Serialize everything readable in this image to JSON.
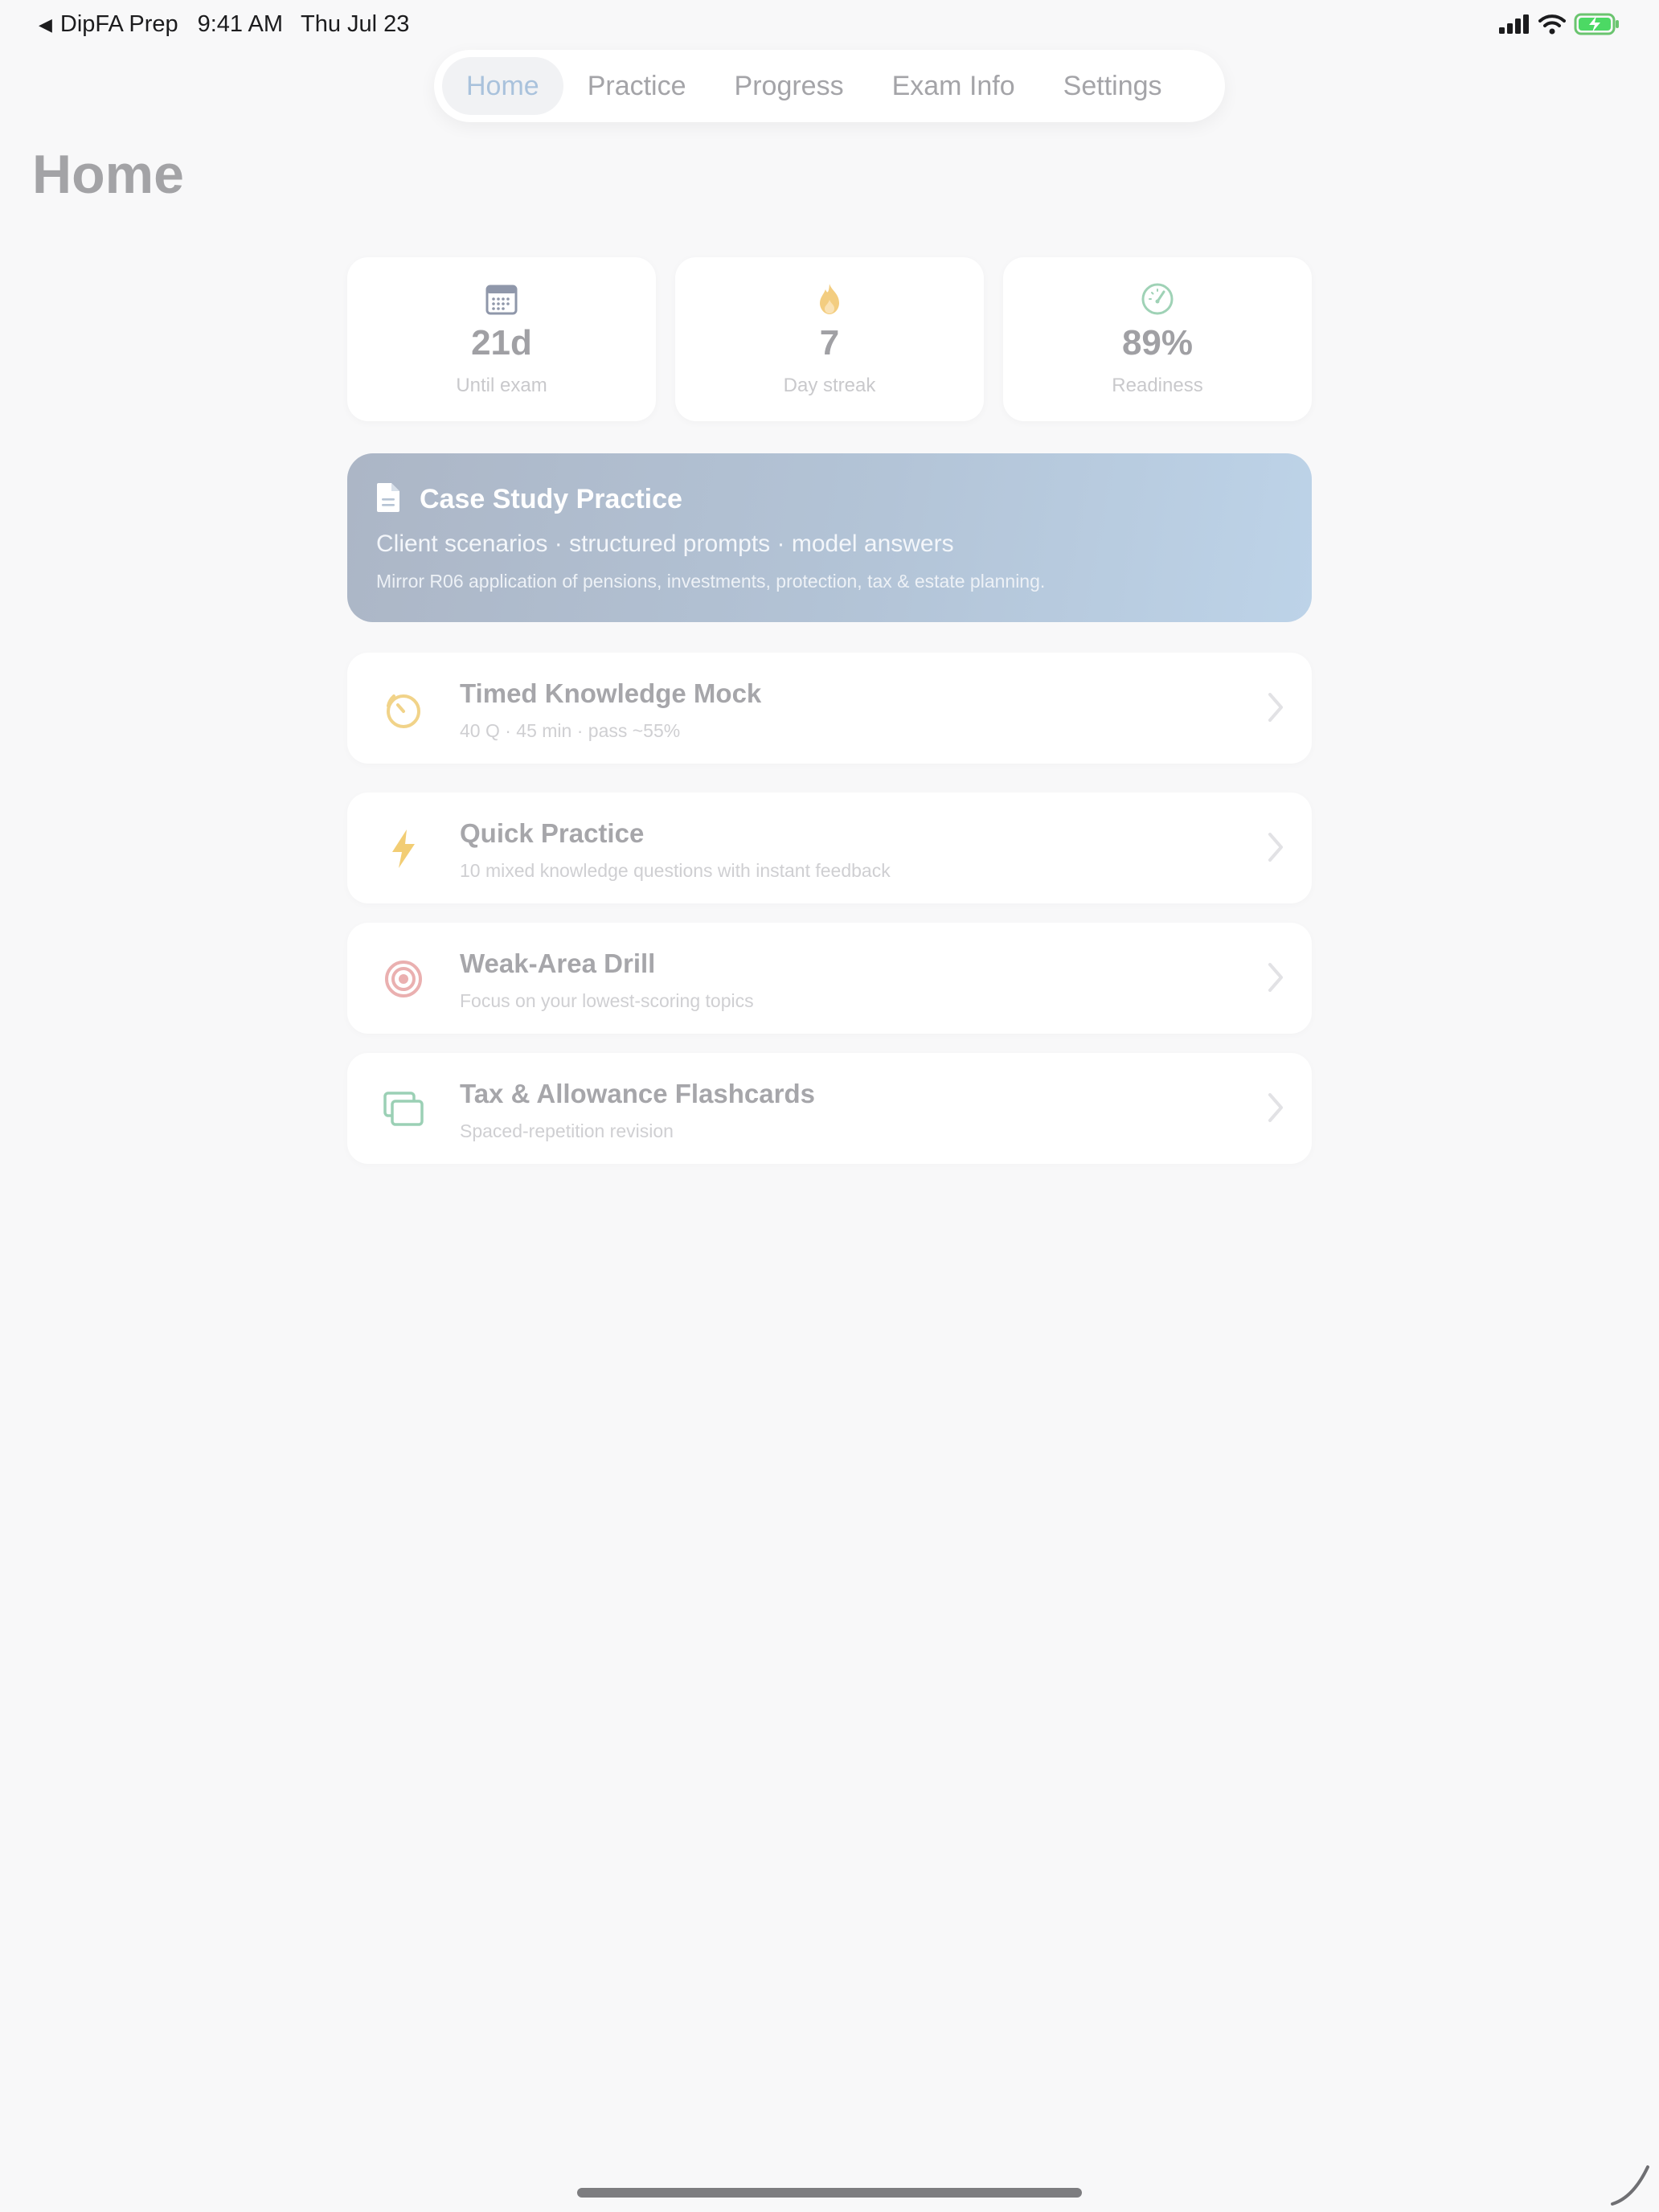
{
  "status_bar": {
    "back_app": "DipFA Prep",
    "time": "9:41 AM",
    "date": "Thu Jul 23"
  },
  "tabs": [
    {
      "label": "Home",
      "active": true
    },
    {
      "label": "Practice",
      "active": false
    },
    {
      "label": "Progress",
      "active": false
    },
    {
      "label": "Exam Info",
      "active": false
    },
    {
      "label": "Settings",
      "active": false
    }
  ],
  "page_title": "Home",
  "stats": [
    {
      "icon": "calendar-icon",
      "value": "21d",
      "label": "Until exam",
      "color": "#8f97aa"
    },
    {
      "icon": "flame-icon",
      "value": "7",
      "label": "Day streak",
      "color": "#f1c87a"
    },
    {
      "icon": "gauge-icon",
      "value": "89%",
      "label": "Readiness",
      "color": "#9fd2b6"
    }
  ],
  "case_study": {
    "icon": "document-icon",
    "title": "Case Study Practice",
    "subtitle": "Client scenarios · structured prompts · model answers",
    "description": "Mirror R06 application of pensions, investments, protection, tax & estate planning."
  },
  "list": [
    {
      "icon": "timer-icon",
      "title": "Timed Knowledge Mock",
      "subtitle": "40 Q · 45 min · pass ~55%",
      "color": "#f1d389"
    },
    {
      "icon": "bolt-icon",
      "title": "Quick Practice",
      "subtitle": "10 mixed knowledge questions with instant feedback",
      "color": "#f2cd74"
    },
    {
      "icon": "target-icon",
      "title": "Weak-Area Drill",
      "subtitle": "Focus on your lowest-scoring topics",
      "color": "#eab0b0"
    },
    {
      "icon": "cards-icon",
      "title": "Tax & Allowance Flashcards",
      "subtitle": "Spaced-repetition revision",
      "color": "#9bd0b5"
    }
  ]
}
